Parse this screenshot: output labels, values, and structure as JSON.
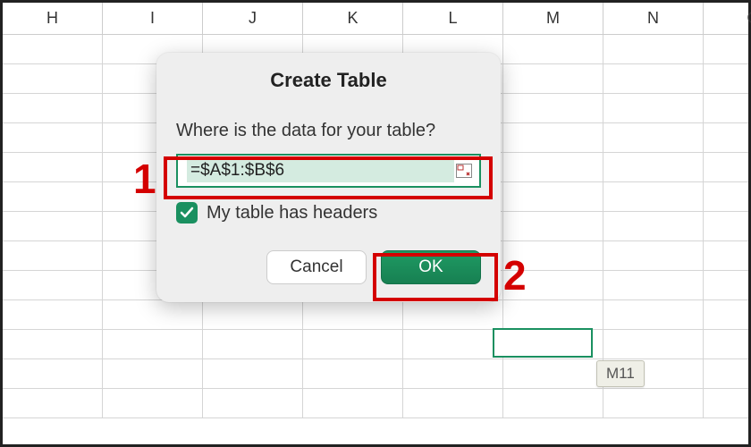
{
  "spreadsheet": {
    "columns": [
      "H",
      "I",
      "J",
      "K",
      "L",
      "M",
      "N",
      "O"
    ],
    "selected_cell_ref": "M11"
  },
  "dialog": {
    "title": "Create Table",
    "prompt": "Where is the data for your table?",
    "range_value": "=$A$1:$B$6",
    "headers_checked": true,
    "headers_label": "My table has headers",
    "cancel_label": "Cancel",
    "ok_label": "OK"
  },
  "annotations": {
    "step1": "1",
    "step2": "2"
  },
  "colors": {
    "accent_green": "#1a9060",
    "annotation_red": "#d40000"
  }
}
